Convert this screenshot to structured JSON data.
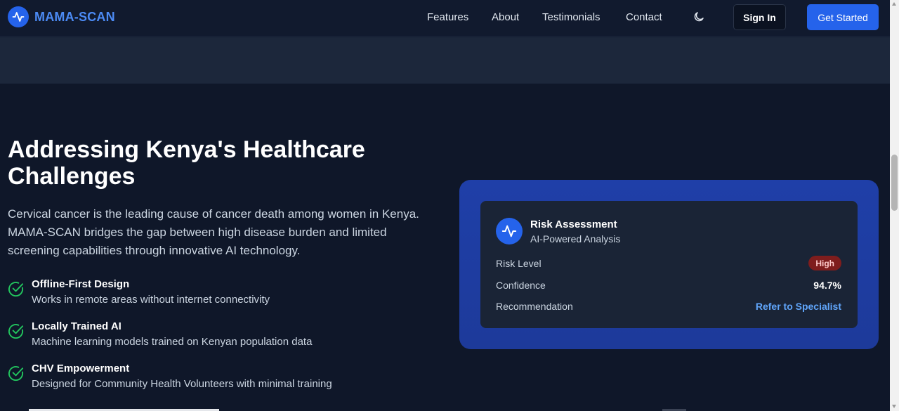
{
  "nav": {
    "brand": "MAMA-SCAN",
    "links": [
      "Features",
      "About",
      "Testimonials",
      "Contact"
    ],
    "theme_icon": "moon-icon",
    "sign_in": "Sign In",
    "get_started": "Get Started"
  },
  "hero": {
    "heading": "Addressing Kenya's Healthcare Challenges",
    "intro": "Cervical cancer is the leading cause of cancer death among women in Kenya. MAMA-SCAN bridges the gap between high disease burden and limited screening capabilities through innovative AI technology."
  },
  "features": [
    {
      "title": "Offline-First Design",
      "desc": "Works in remote areas without internet connectivity",
      "icon": "check-circle-icon"
    },
    {
      "title": "Locally Trained AI",
      "desc": "Machine learning models trained on Kenyan population data",
      "icon": "check-circle-icon"
    },
    {
      "title": "CHV Empowerment",
      "desc": "Designed for Community Health Volunteers with minimal training",
      "icon": "check-circle-icon"
    }
  ],
  "card": {
    "title": "Risk Assessment",
    "subtitle": "AI-Powered Analysis",
    "icon": "activity-icon",
    "rows": {
      "risk_label": "Risk Level",
      "risk_value": "High",
      "confidence_label": "Confidence",
      "confidence_value": "94.7%",
      "recommendation_label": "Recommendation",
      "recommendation_value": "Refer to Specialist"
    }
  },
  "colors": {
    "background": "#0f1729",
    "accent": "#2563eb",
    "brand_text": "#4c8bf5",
    "check_green": "#22c55e",
    "badge_red": "#7f1d1d",
    "link_blue": "#60a5fa"
  }
}
